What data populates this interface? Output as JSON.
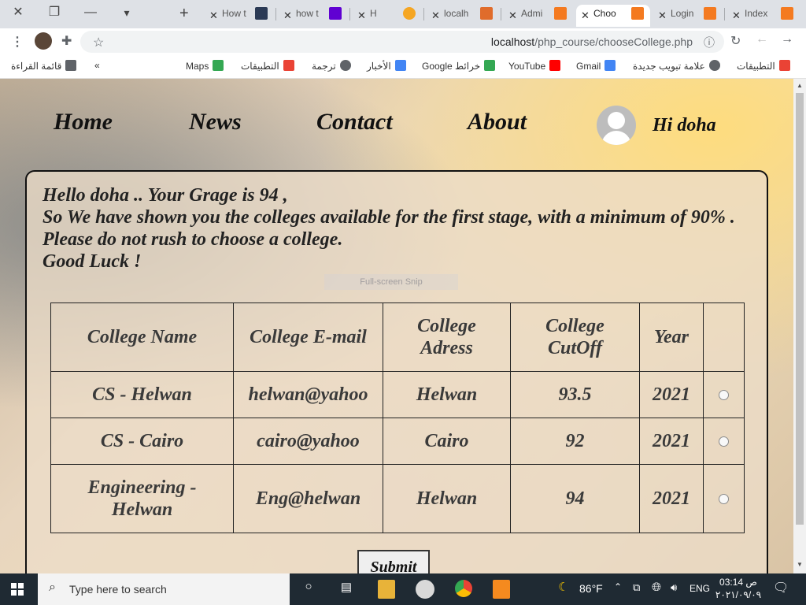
{
  "browser": {
    "tabs": [
      {
        "title": "How t",
        "favicon_color": "#2b3a55"
      },
      {
        "title": "how t",
        "favicon_color": "#6001d2"
      },
      {
        "title": "H",
        "favicon_color": "#f5a623"
      },
      {
        "title": "localh",
        "favicon_color": "#e06c2b"
      },
      {
        "title": "Admi",
        "favicon_color": "#f47a20"
      },
      {
        "title": "Choo",
        "favicon_color": "#f47a20",
        "active": true
      },
      {
        "title": "Login",
        "favicon_color": "#f47a20"
      },
      {
        "title": "Index",
        "favicon_color": "#f47a20"
      }
    ],
    "address": {
      "host": "localhost",
      "path": "/php_course/chooseCollege.php"
    },
    "bookmarks": [
      {
        "label": "التطبيقات",
        "color": "#ea4335"
      },
      {
        "label": "علامة تبويب جديدة",
        "color": "#5f6368"
      },
      {
        "label": "Gmail",
        "color": "#4285f4"
      },
      {
        "label": "YouTube",
        "color": "#ff0000"
      },
      {
        "label": "خرائط Google",
        "color": "#34a853"
      },
      {
        "label": "الأخبار",
        "color": "#4285f4"
      },
      {
        "label": "ترجمة",
        "color": "#5f6368"
      },
      {
        "label": "التطبيقات",
        "color": "#ea4335"
      },
      {
        "label": "Maps",
        "color": "#34a853"
      }
    ],
    "reading_list": "قائمة القراءة",
    "overflow": "»"
  },
  "nav": {
    "home": "Home",
    "news": "News",
    "contact": "Contact",
    "about": "About",
    "greeting": "Hi doha"
  },
  "intro": {
    "line1": "Hello doha .. Your Grage is 94 ,",
    "line2": "So We have shown you the colleges available for the first stage, with a minimum of 90% .",
    "line3": "Please do not rush to choose a college.",
    "line4": "Good Luck !"
  },
  "overlay": {
    "snip": "Full-screen Snip"
  },
  "table": {
    "headers": [
      "College Name",
      "College E-mail",
      "College Adress",
      "College CutOff",
      "Year",
      ""
    ],
    "rows": [
      {
        "name": "CS - Helwan",
        "email": "helwan@yahoo",
        "address": "Helwan",
        "cutoff": "93.5",
        "year": "2021"
      },
      {
        "name": "CS - Cairo",
        "email": "cairo@yahoo",
        "address": "Cairo",
        "cutoff": "92",
        "year": "2021"
      },
      {
        "name": "Engineering - Helwan",
        "email": "Eng@helwan",
        "address": "Helwan",
        "cutoff": "94",
        "year": "2021"
      }
    ]
  },
  "form": {
    "submit": "Submit"
  },
  "taskbar": {
    "search_placeholder": "Type here to search",
    "weather": "86°F",
    "lang": "ENG",
    "time": "03:14 ص",
    "date": "٢٠٢١/٠٩/٠٩"
  }
}
